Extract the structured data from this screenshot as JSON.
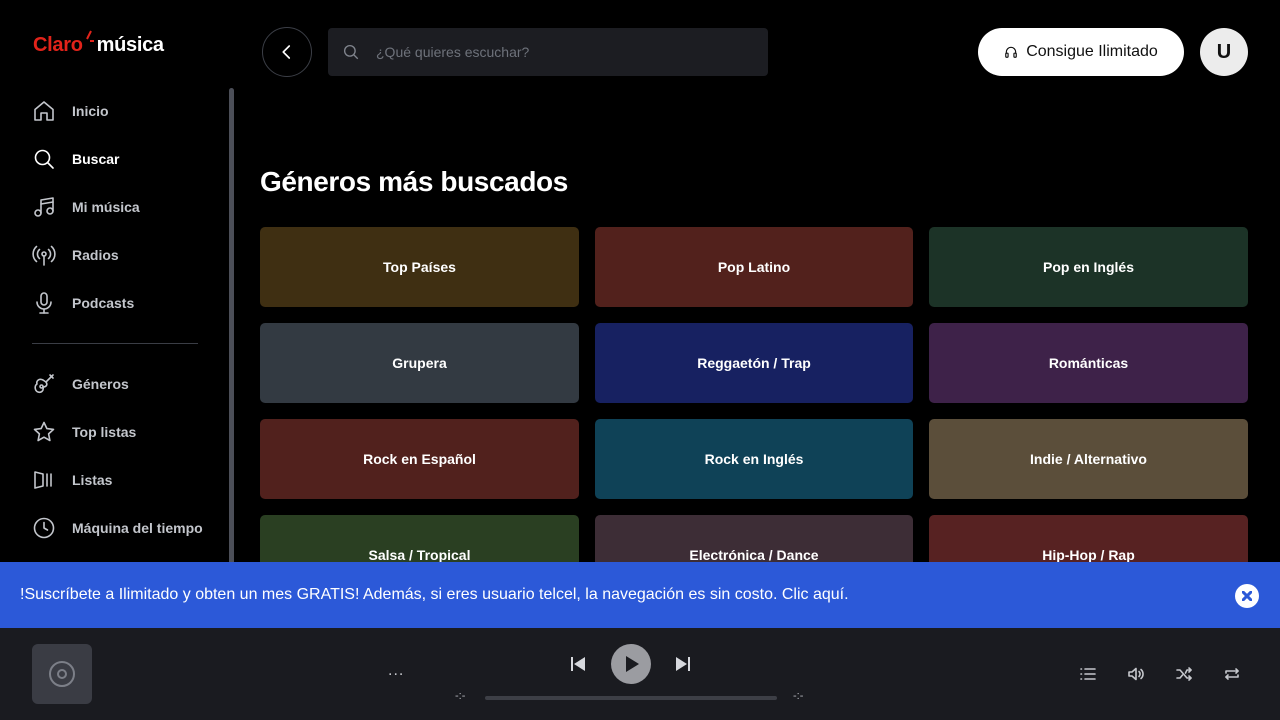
{
  "brand": {
    "name_part1": "Claro",
    "mark": "·",
    "name_part2": "música",
    "accent_color": "#e2231a"
  },
  "sidebar": {
    "primary": [
      {
        "label": "Inicio",
        "icon": "home-icon",
        "active": false
      },
      {
        "label": "Buscar",
        "icon": "search-icon",
        "active": true
      },
      {
        "label": "Mi música",
        "icon": "music-note-icon",
        "active": false
      },
      {
        "label": "Radios",
        "icon": "radio-antenna-icon",
        "active": false
      },
      {
        "label": "Podcasts",
        "icon": "microphone-icon",
        "active": false
      }
    ],
    "secondary": [
      {
        "label": "Géneros",
        "icon": "guitar-icon"
      },
      {
        "label": "Top listas",
        "icon": "star-icon"
      },
      {
        "label": "Listas",
        "icon": "playlist-icon"
      },
      {
        "label": "Máquina del tiempo",
        "icon": "clock-icon"
      }
    ]
  },
  "header": {
    "search_placeholder": "¿Qué quieres escuchar?",
    "cta_label": "Consigue Ilimitado",
    "avatar_initial": "U"
  },
  "main": {
    "section_title": "Géneros más buscados",
    "genres": [
      {
        "label": "Top Países",
        "color": "#3f2f12"
      },
      {
        "label": "Pop Latino",
        "color": "#52211c"
      },
      {
        "label": "Pop en Inglés",
        "color": "#1c3327"
      },
      {
        "label": "Grupera",
        "color": "#333a42"
      },
      {
        "label": "Reggaetón / Trap",
        "color": "#172161"
      },
      {
        "label": "Románticas",
        "color": "#3e2249"
      },
      {
        "label": "Rock en Español",
        "color": "#51211d"
      },
      {
        "label": "Rock en Inglés",
        "color": "#0f4257"
      },
      {
        "label": "Indie / Alternativo",
        "color": "#5b4e3a"
      },
      {
        "label": "Salsa / Tropical",
        "color": "#2a3f22"
      },
      {
        "label": "Electrónica / Dance",
        "color": "#3d2d36"
      },
      {
        "label": "Hip-Hop / Rap",
        "color": "#572222"
      }
    ]
  },
  "banner": {
    "text": "!Suscríbete a Ilimitado y obten un mes GRATIS! Además, si eres usuario telcel, la navegación es sin costo. Clic aquí.",
    "color": "#2c59d8"
  },
  "player": {
    "track_more": "...",
    "time_elapsed": "-:-",
    "time_total": "-:-",
    "progress": 0
  }
}
